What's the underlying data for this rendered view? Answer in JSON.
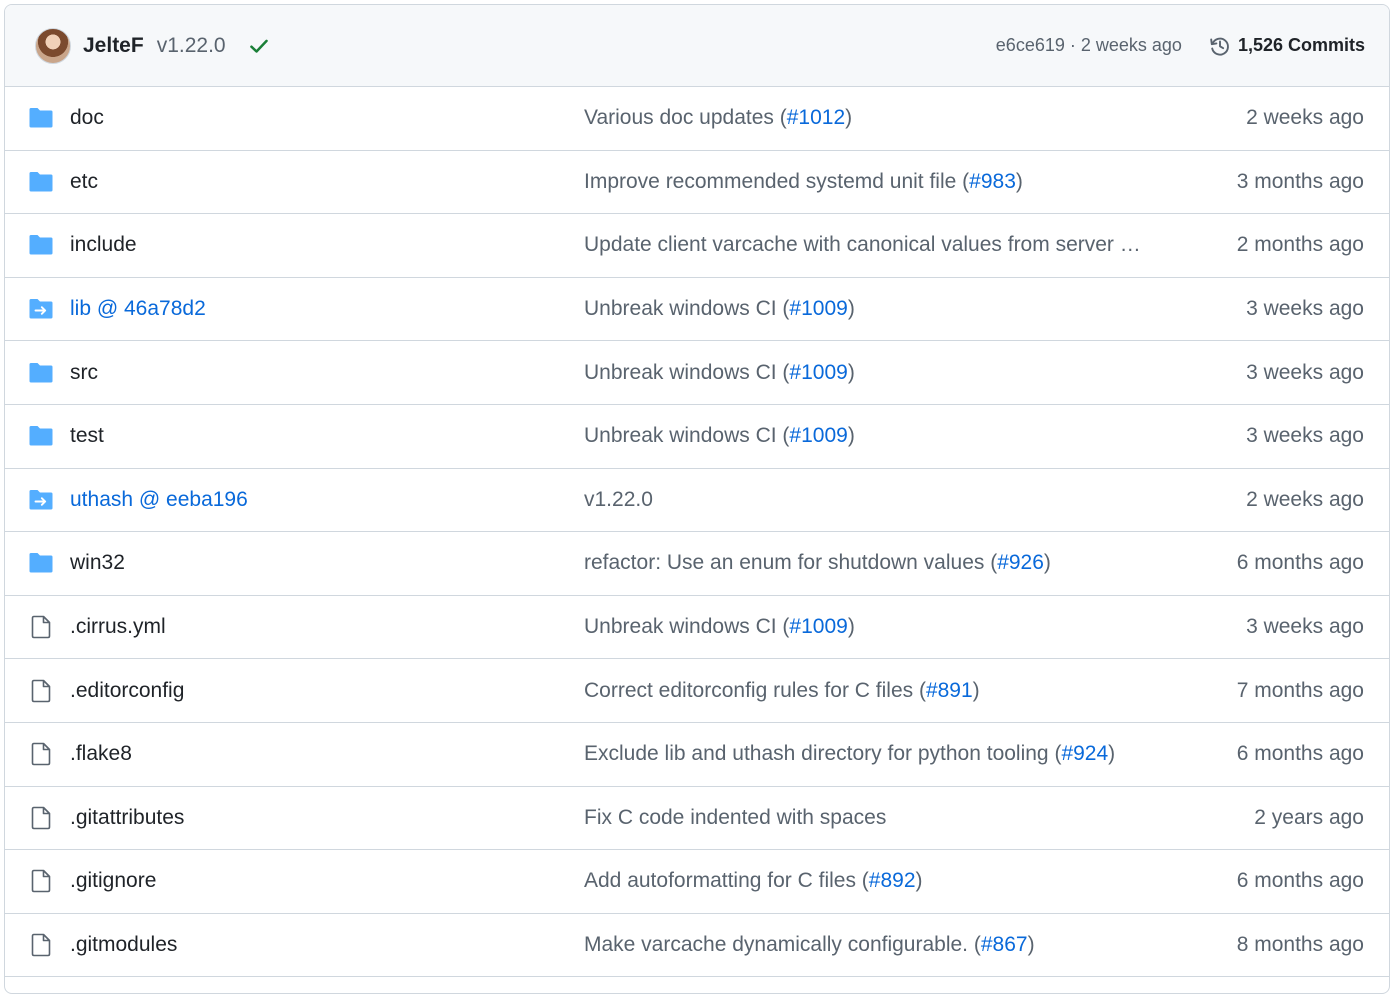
{
  "header": {
    "author": "JelteF",
    "tag": "v1.22.0",
    "sha_time": "e6ce619 · 2 weeks ago",
    "commits": "1,526 Commits",
    "status_color": "#1a7f37"
  },
  "colors": {
    "folder": "#54aeff",
    "link": "#0969da",
    "muted": "#59636e",
    "border": "#d0d7de"
  },
  "files": [
    {
      "name": "doc",
      "type": "folder",
      "msg": "Various doc updates (",
      "pr": "#1012",
      "end": ")",
      "time": "2 weeks ago"
    },
    {
      "name": "etc",
      "type": "folder",
      "msg": "Improve recommended systemd unit file (",
      "pr": "#983",
      "end": ")",
      "time": "3 months ago"
    },
    {
      "name": "include",
      "type": "folder",
      "msg": "Update client varcache with canonical values from server …",
      "pr": "",
      "end": "",
      "time": "2 months ago"
    },
    {
      "name": "lib @ 46a78d2",
      "type": "submodule",
      "msg": "Unbreak windows CI (",
      "pr": "#1009",
      "end": ")",
      "time": "3 weeks ago"
    },
    {
      "name": "src",
      "type": "folder",
      "msg": "Unbreak windows CI (",
      "pr": "#1009",
      "end": ")",
      "time": "3 weeks ago"
    },
    {
      "name": "test",
      "type": "folder",
      "msg": "Unbreak windows CI (",
      "pr": "#1009",
      "end": ")",
      "time": "3 weeks ago"
    },
    {
      "name": "uthash @ eeba196",
      "type": "submodule",
      "msg": "v1.22.0",
      "pr": "",
      "end": "",
      "time": "2 weeks ago"
    },
    {
      "name": "win32",
      "type": "folder",
      "msg": "refactor: Use an enum for shutdown values (",
      "pr": "#926",
      "end": ")",
      "time": "6 months ago"
    },
    {
      "name": ".cirrus.yml",
      "type": "file",
      "msg": "Unbreak windows CI (",
      "pr": "#1009",
      "end": ")",
      "time": "3 weeks ago"
    },
    {
      "name": ".editorconfig",
      "type": "file",
      "msg": "Correct editorconfig rules for C files (",
      "pr": "#891",
      "end": ")",
      "time": "7 months ago"
    },
    {
      "name": ".flake8",
      "type": "file",
      "msg": "Exclude lib and uthash directory for python tooling (",
      "pr": "#924",
      "end": ")",
      "time": "6 months ago"
    },
    {
      "name": ".gitattributes",
      "type": "file",
      "msg": "Fix C code indented with spaces",
      "pr": "",
      "end": "",
      "time": "2 years ago"
    },
    {
      "name": ".gitignore",
      "type": "file",
      "msg": "Add autoformatting for C files (",
      "pr": "#892",
      "end": ")",
      "time": "6 months ago"
    },
    {
      "name": ".gitmodules",
      "type": "file",
      "msg": "Make varcache dynamically configurable. (",
      "pr": "#867",
      "end": ")",
      "time": "8 months ago"
    }
  ]
}
